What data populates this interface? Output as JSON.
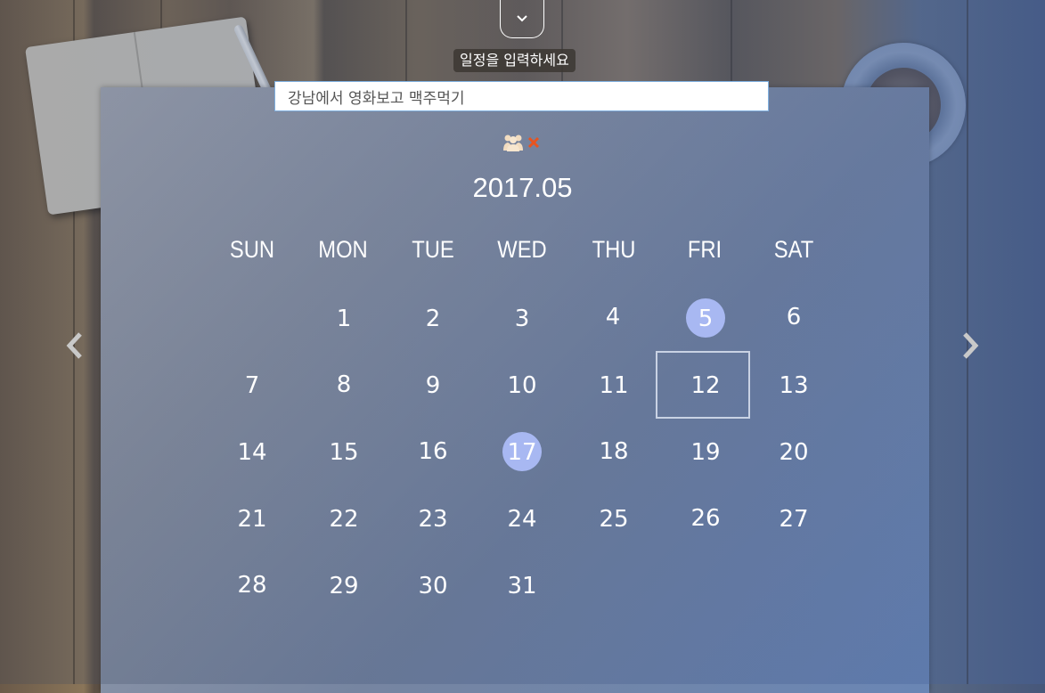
{
  "prompt_label": "일정을 입력하세요",
  "input": {
    "value": "강남에서 영화보고 맥주먹기"
  },
  "month_title": "2017.05",
  "weekdays": [
    "SUN",
    "MON",
    "TUE",
    "WED",
    "THU",
    "FRI",
    "SAT"
  ],
  "days": [
    "1",
    "2",
    "3",
    "4",
    "5",
    "6",
    "7",
    "8",
    "9",
    "10",
    "11",
    "12",
    "13",
    "14",
    "15",
    "16",
    "17",
    "18",
    "19",
    "20",
    "21",
    "22",
    "23",
    "24",
    "25",
    "26",
    "27",
    "28",
    "29",
    "30",
    "31"
  ],
  "marked_days": [
    "5",
    "17"
  ],
  "today": "12",
  "colors": {
    "marked": "#a8b8f2",
    "close_icon": "#e8541f",
    "people_icon": "#f2dcc0"
  },
  "icons": {
    "toggle": "chevron-down-icon",
    "people": "people-icon",
    "close": "close-icon",
    "prev": "chevron-left-icon",
    "next": "chevron-right-icon"
  }
}
